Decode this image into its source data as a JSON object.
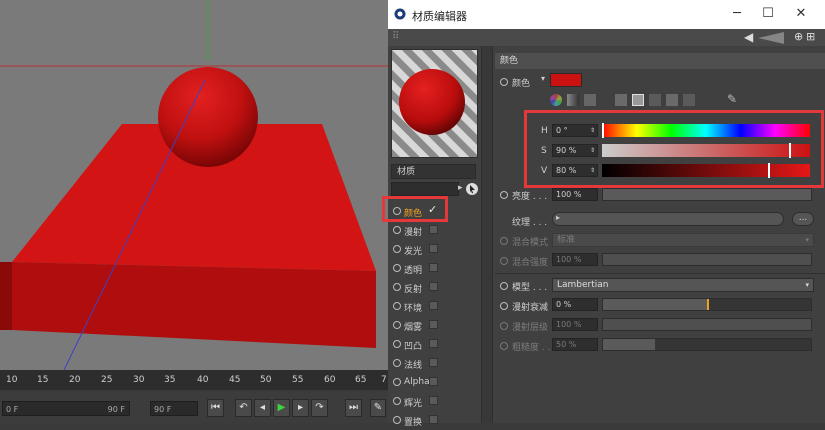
{
  "editor": {
    "title": "材质编辑器",
    "window_buttons": [
      "─",
      "☐",
      "✕"
    ]
  },
  "timeline": {
    "ticks": [
      "10",
      "15",
      "20",
      "25",
      "30",
      "35",
      "40",
      "45",
      "50",
      "55",
      "60",
      "65",
      "7"
    ],
    "start_field": "0 F",
    "end_field": "90 F",
    "max_field": "90 F"
  },
  "material": {
    "name_label": "材质",
    "channels": [
      {
        "label": "颜色",
        "checked": true,
        "active": true
      },
      {
        "label": "漫射",
        "checked": false
      },
      {
        "label": "发光",
        "checked": false
      },
      {
        "label": "透明",
        "checked": false
      },
      {
        "label": "反射",
        "checked": false
      },
      {
        "label": "环境",
        "checked": false
      },
      {
        "label": "烟雾",
        "checked": false
      },
      {
        "label": "凹凸",
        "checked": false
      },
      {
        "label": "法线",
        "checked": false
      },
      {
        "label": "Alpha",
        "checked": false
      },
      {
        "label": "辉光",
        "checked": false
      },
      {
        "label": "置换",
        "checked": false
      }
    ],
    "check_mark": "✓"
  },
  "color_panel": {
    "section_title": "颜色",
    "color_label": "颜色",
    "swatch_color": "#cc1111",
    "h_label": "H",
    "h_value": "0 °",
    "s_label": "S",
    "s_value": "90 %",
    "v_label": "V",
    "v_value": "80 %",
    "s_level": 0.9,
    "v_level": 0.8,
    "brightness_label": "亮度 . . .",
    "brightness_value": "100 %",
    "texture_label": "纹理 . . .",
    "texture_more": "...",
    "blend_mode_label": "混合模式",
    "blend_mode_value": "标准",
    "blend_strength_label": "混合强度",
    "blend_strength_value": "100 %",
    "model_label": "模型 . . .",
    "model_value": "Lambertian",
    "diffuse_falloff_label": "漫射衰减",
    "diffuse_falloff_value": "0 %",
    "diffuse_level_label": "漫射层级",
    "diffuse_level_value": "100 %",
    "roughness_label": "粗糙度 . .",
    "roughness_value": "50 %"
  },
  "colors": {
    "highlight": "#e5383b",
    "accent": "#f0a020",
    "material_red": "#cc1111"
  }
}
